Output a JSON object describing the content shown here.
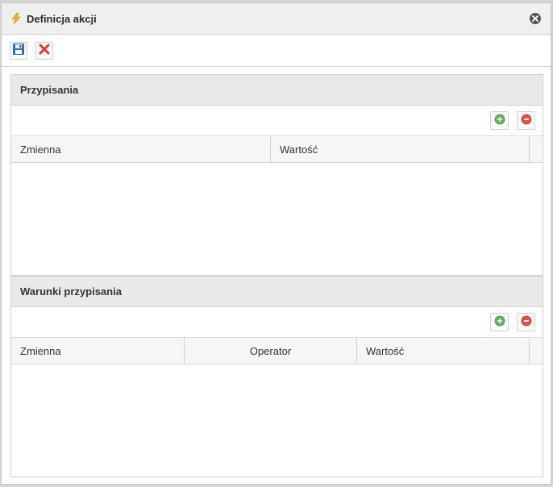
{
  "window": {
    "title": "Definicja akcji"
  },
  "toolbar": {
    "save_icon": "floppy-disk-icon",
    "cancel_icon": "red-x-icon"
  },
  "assignments": {
    "title": "Przypisania",
    "columns": [
      "Zmienna",
      "Wartość"
    ],
    "rows": []
  },
  "conditions": {
    "title": "Warunki przypisania",
    "columns": [
      "Zmienna",
      "Operator",
      "Wartość"
    ],
    "rows": []
  },
  "colors": {
    "add": "#5cb85c",
    "remove": "#e0533f",
    "header_bg": "#e9e9e9"
  }
}
